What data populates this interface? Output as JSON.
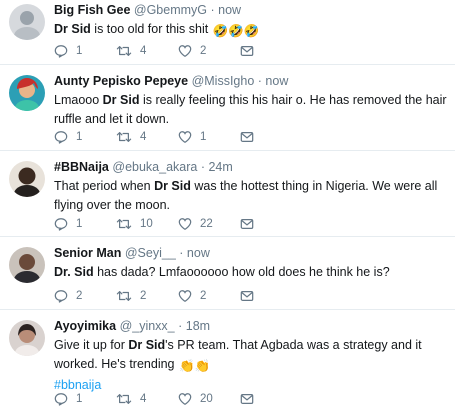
{
  "tweets": [
    {
      "name": "Big Fish Gee",
      "handle": "@GbemmyG",
      "separator": "·",
      "time": "now",
      "text_pre": "",
      "mention": "Dr Sid",
      "text_post": " is too old for this shit",
      "emoji": "🤣🤣🤣",
      "counts": {
        "reply": "1",
        "retweet": "4",
        "like": "2"
      },
      "avatar_color": "#d6d9dd"
    },
    {
      "name": "Aunty Pepisko Pepeye",
      "handle": "@MissIgho",
      "separator": "·",
      "time": "now",
      "text_pre": "Lmaooo ",
      "mention": "Dr Sid",
      "text_post": " is really feeling this his hair o. He has removed the hair ruffle and let it down.",
      "counts": {
        "reply": "1",
        "retweet": "4",
        "like": "1"
      },
      "avatar_color": "#2c9fb5"
    },
    {
      "name": "#BBNaija",
      "handle": "@ebuka_akara",
      "separator": "·",
      "time": "24m",
      "text_pre": "That period when ",
      "mention": "Dr Sid",
      "text_post": " was the hottest thing in Nigeria. We were all flying over the moon.",
      "counts": {
        "reply": "1",
        "retweet": "10",
        "like": "22"
      },
      "avatar_color": "#3b2a20"
    },
    {
      "name": "Senior Man",
      "handle": "@Seyi__",
      "separator": "·",
      "time": "now",
      "text_pre": "",
      "mention": "Dr. Sid",
      "text_post": " has dada? Lmfaoooooo how old does he think he is?",
      "counts": {
        "reply": "2",
        "retweet": "2",
        "like": "2"
      },
      "avatar_color": "#6a4a3a"
    },
    {
      "name": "Ayoyimika",
      "handle": "@_yinxx_",
      "separator": "·",
      "time": "18m",
      "text_pre": "Give it up for ",
      "mention": "Dr Sid",
      "text_post": "'s PR team. That Agbada was a strategy and it worked. He's trending",
      "emoji": "👏👏",
      "hashtag": "#bbnaija",
      "counts": {
        "reply": "1",
        "retweet": "4",
        "like": "20"
      },
      "avatar_color": "#d9d2cf"
    }
  ],
  "colors": {
    "accent": "#1da1f2",
    "muted": "#657786",
    "divider": "#e6ecf0"
  }
}
